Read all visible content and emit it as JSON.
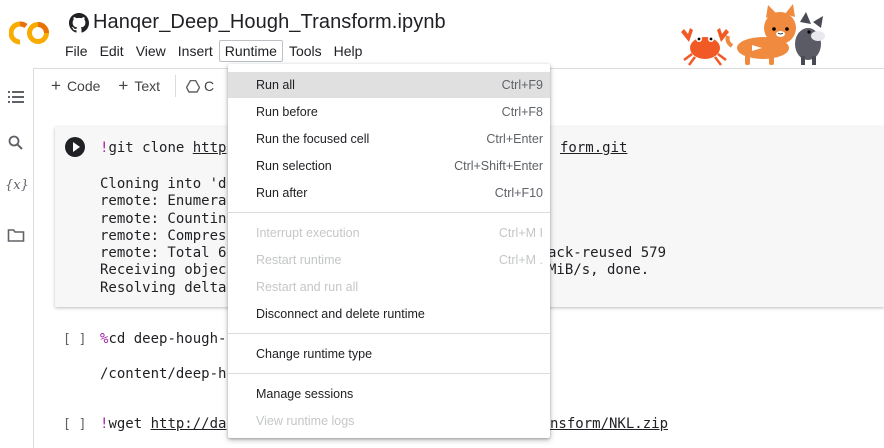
{
  "header": {
    "logo_text": "CO",
    "title": "Hanqer_Deep_Hough_Transform.ipynb",
    "menu": [
      "File",
      "Edit",
      "View",
      "Insert",
      "Runtime",
      "Tools",
      "Help"
    ],
    "active_menu": "Runtime"
  },
  "sidebar": {
    "variables_label": "{x}"
  },
  "toolbar": {
    "add_code": "Code",
    "add_text": "Text",
    "drive_label": "C"
  },
  "cells": {
    "cell1": {
      "code_prefix": "!",
      "code_cmd": "git clone ",
      "code_url_left": "http",
      "code_url_right": "form.git",
      "output": [
        "Cloning into 'd",
        "remote: Enumera",
        "remote: Countin",
        "remote: Compres",
        "remote: Total 6",
        "Receiving objec",
        "Resolving delta"
      ],
      "output_right": [
        "ack-reused 579",
        "MiB/s, done."
      ]
    },
    "cell2": {
      "bracket": "[ ]",
      "code_prefix": "%",
      "code_rest": "cd deep-hough-",
      "output": "/content/deep-h"
    },
    "cell3": {
      "bracket": "[ ]",
      "code_prefix": "!",
      "code_cmd": "wget ",
      "code_url_left": "http://da",
      "code_url_right": "nsform/NKL.zip"
    }
  },
  "runtime_menu": {
    "items": [
      {
        "label": "Run all",
        "shortcut": "Ctrl+F9",
        "enabled": true,
        "hover": true
      },
      {
        "label": "Run before",
        "shortcut": "Ctrl+F8",
        "enabled": true
      },
      {
        "label": "Run the focused cell",
        "shortcut": "Ctrl+Enter",
        "enabled": true
      },
      {
        "label": "Run selection",
        "shortcut": "Ctrl+Shift+Enter",
        "enabled": true
      },
      {
        "label": "Run after",
        "shortcut": "Ctrl+F10",
        "enabled": true
      },
      {
        "label": "Interrupt execution",
        "shortcut": "Ctrl+M I",
        "enabled": false
      },
      {
        "label": "Restart runtime",
        "shortcut": "Ctrl+M .",
        "enabled": false
      },
      {
        "label": "Restart and run all",
        "shortcut": "",
        "enabled": false
      },
      {
        "label": "Disconnect and delete runtime",
        "shortcut": "",
        "enabled": true
      },
      {
        "label": "Change runtime type",
        "shortcut": "",
        "enabled": true
      },
      {
        "label": "Manage sessions",
        "shortcut": "",
        "enabled": true
      },
      {
        "label": "View runtime logs",
        "shortcut": "",
        "enabled": false
      }
    ]
  },
  "colors": {
    "logo_orange": "#F9AB00",
    "logo_dark_orange": "#E8710A",
    "magic_purple": "#A626A4",
    "menu_hover": "#E0E0E0",
    "disabled_text": "#C4C7C5"
  }
}
